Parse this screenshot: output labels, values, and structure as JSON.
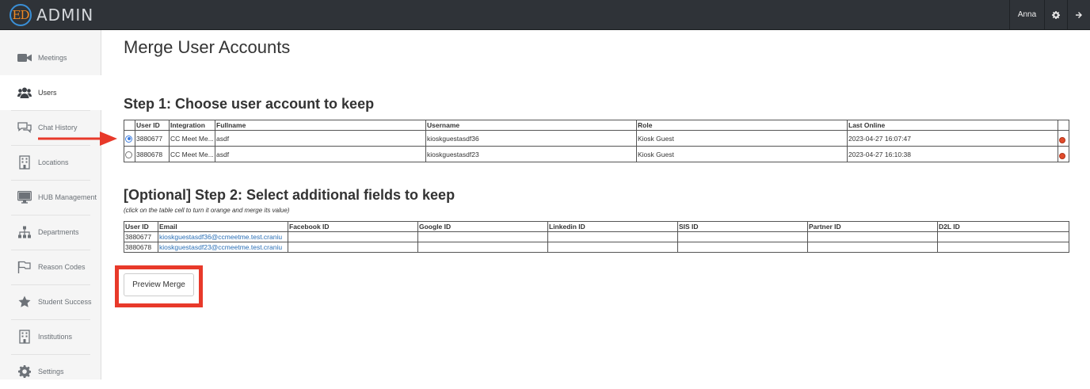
{
  "header": {
    "logo_mark": "ED",
    "logo_text": "ADMIN",
    "user_name": "Anna",
    "icons": {
      "settings": "gear-icon",
      "logout": "arrow-right-icon"
    }
  },
  "sidebar": {
    "items": [
      {
        "label": "Meetings",
        "icon": "video-camera-icon",
        "active": false
      },
      {
        "label": "Users",
        "icon": "users-icon",
        "active": true
      },
      {
        "label": "Chat History",
        "icon": "chat-bubbles-icon",
        "active": false
      },
      {
        "label": "Locations",
        "icon": "building-icon",
        "active": false
      },
      {
        "label": "HUB Management",
        "icon": "monitor-icon",
        "active": false
      },
      {
        "label": "Departments",
        "icon": "org-chart-icon",
        "active": false
      },
      {
        "label": "Reason Codes",
        "icon": "flag-icon",
        "active": false
      },
      {
        "label": "Student Success",
        "icon": "star-icon",
        "active": false
      },
      {
        "label": "Institutions",
        "icon": "building-icon",
        "active": false
      },
      {
        "label": "Settings",
        "icon": "gear-icon",
        "active": false
      }
    ]
  },
  "main": {
    "title": "Merge User Accounts",
    "step1": {
      "heading": "Step 1: Choose user account to keep",
      "columns": [
        "User ID",
        "Integration",
        "Fullname",
        "Username",
        "Role",
        "Last Online"
      ],
      "rows": [
        {
          "selected": true,
          "user_id": "3880677",
          "integration": "CC Meet Me...",
          "fullname": "asdf",
          "username": "kioskguestasdf36",
          "role": "Kiosk Guest",
          "last_online": "2023-04-27 16:07:47"
        },
        {
          "selected": false,
          "user_id": "3880678",
          "integration": "CC Meet Me...",
          "fullname": "asdf",
          "username": "kioskguestasdf23",
          "role": "Kiosk Guest",
          "last_online": "2023-04-27 16:10:38"
        }
      ]
    },
    "step2": {
      "heading": "[Optional] Step 2: Select additional fields to keep",
      "hint": "(click on the table cell to turn it orange and merge its value)",
      "columns": [
        "User ID",
        "Email",
        "Facebook ID",
        "Google ID",
        "Linkedin ID",
        "SIS ID",
        "Partner ID",
        "D2L ID"
      ],
      "rows": [
        {
          "user_id": "3880677",
          "email": "kioskguestasdf36@ccmeetme.test.craniu",
          "facebook_id": "",
          "google_id": "",
          "linkedin_id": "",
          "sis_id": "",
          "partner_id": "",
          "d2l_id": ""
        },
        {
          "user_id": "3880678",
          "email": "kioskguestasdf23@ccmeetme.test.craniu",
          "facebook_id": "",
          "google_id": "",
          "linkedin_id": "",
          "sis_id": "",
          "partner_id": "",
          "d2l_id": ""
        }
      ]
    },
    "preview_button": "Preview Merge"
  },
  "colors": {
    "topbar": "#2f3338",
    "annotation_red": "#e8392a",
    "link": "#2a6fb6",
    "radio_blue": "#3b7de0"
  }
}
